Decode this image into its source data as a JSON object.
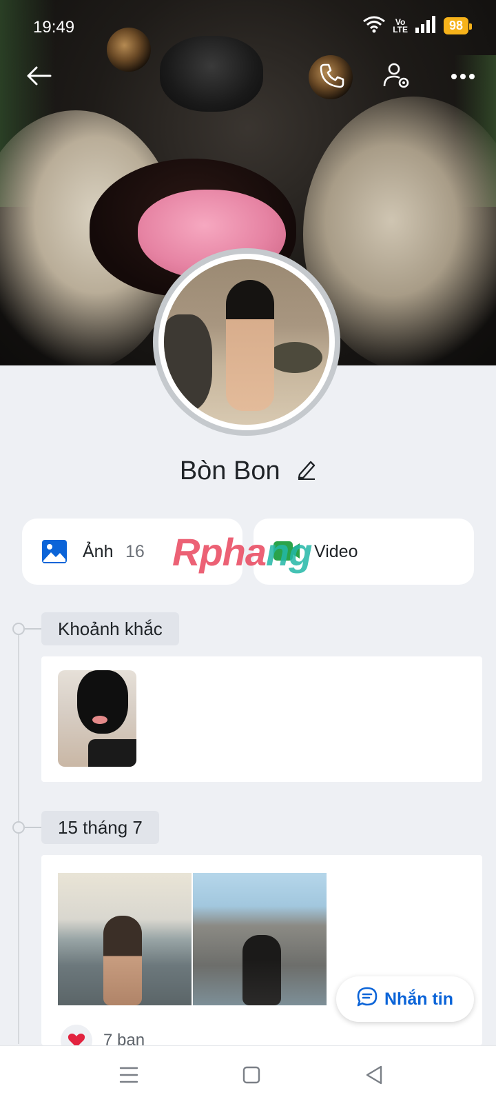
{
  "status_bar": {
    "time": "19:49",
    "volte_top": "Vo",
    "volte_bottom": "LTE",
    "battery": "98"
  },
  "profile": {
    "name": "Bòn Bon"
  },
  "media": {
    "photos_label": "Ảnh",
    "photos_count": "16",
    "videos_label": "Video"
  },
  "watermark": {
    "part1": "Rpha",
    "part2": "ng"
  },
  "timeline": {
    "sections": [
      {
        "label": "Khoảnh khắc"
      },
      {
        "label": "15 tháng 7"
      }
    ],
    "likes_text": "7 bạn"
  },
  "actions": {
    "message_label": "Nhắn tin"
  },
  "colors": {
    "accent": "#0b64d8",
    "battery": "#f6b21a",
    "background": "#eef0f4"
  },
  "icons": [
    "back-arrow-icon",
    "phone-icon",
    "user-settings-icon",
    "more-icon",
    "edit-pencil-icon",
    "image-icon",
    "video-icon",
    "heart-icon",
    "chat-icon",
    "menu-icon",
    "home-icon",
    "back-triangle-icon"
  ]
}
